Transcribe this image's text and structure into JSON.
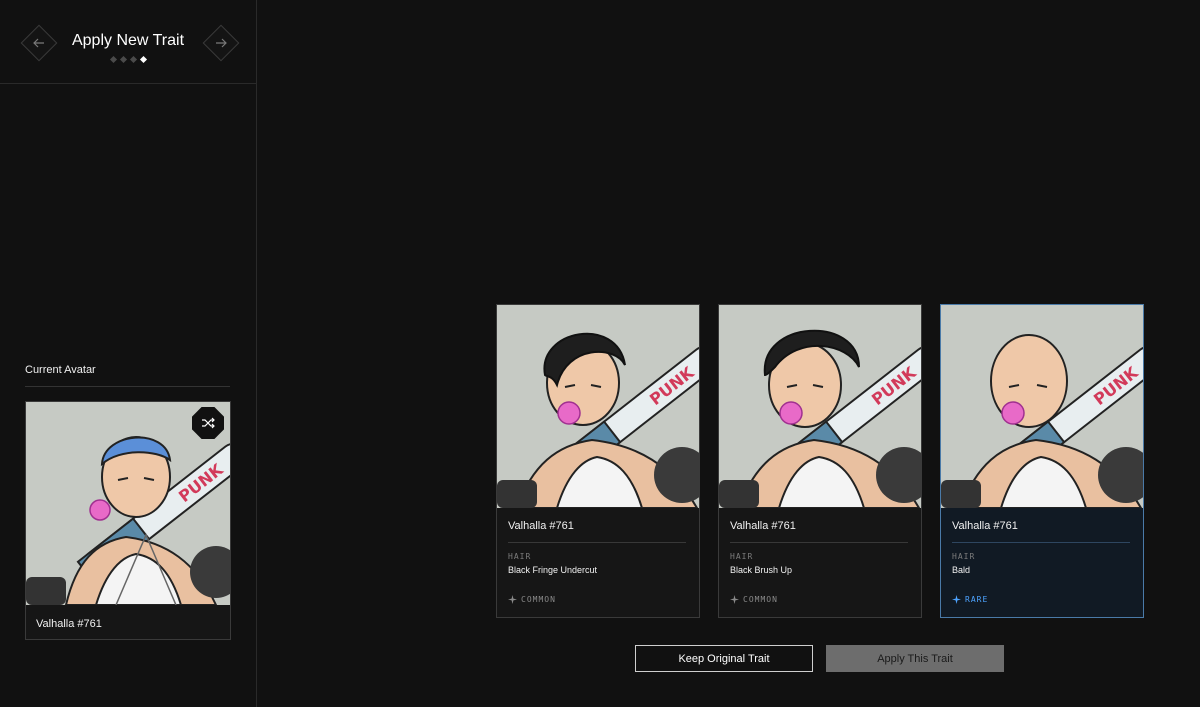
{
  "header": {
    "title": "Apply New Trait",
    "step_count": 4,
    "active_step": 4
  },
  "current_avatar": {
    "label": "Current Avatar",
    "name": "Valhalla #761"
  },
  "trait_options": [
    {
      "title": "Valhalla #761",
      "category": "HAIR",
      "value": "Black Fringe Undercut",
      "rarity": "COMMON",
      "hair_style": "fringe-undercut"
    },
    {
      "title": "Valhalla #761",
      "category": "HAIR",
      "value": "Black Brush Up",
      "rarity": "COMMON",
      "hair_style": "brush-up"
    },
    {
      "title": "Valhalla #761",
      "category": "HAIR",
      "value": "Bald",
      "rarity": "RARE",
      "hair_style": "bald"
    }
  ],
  "selected_index": 2,
  "actions": {
    "keep_label": "Keep Original Trait",
    "apply_label": "Apply This Trait"
  },
  "colors": {
    "background": "#111111",
    "selected_border": "#4a7aa8",
    "rare": "#4da3ff",
    "apply_button": "#6d6d6d"
  },
  "icons": [
    "arrow-left-icon",
    "arrow-right-icon",
    "shuffle-icon",
    "sparkle-icon"
  ]
}
